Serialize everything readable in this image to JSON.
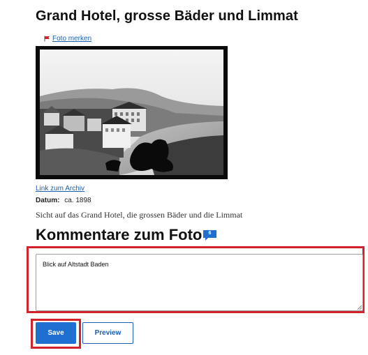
{
  "photo": {
    "title": "Grand Hotel, grosse Bäder und Limmat",
    "bookmark_label": "Foto merken",
    "bookmark_icon": "flag-icon",
    "archive_link": "Link zum Archiv",
    "date_label": "Datum:",
    "date_value": "ca. 1898",
    "description": "Sicht auf das Grand Hotel, die grossen Bäder und die Limmat"
  },
  "comments": {
    "heading": "Kommentare zum Foto",
    "count": "6",
    "count_icon": "speech-bubble-icon",
    "textarea_value": "Blick auf Altstadt Baden",
    "save_label": "Save",
    "preview_label": "Preview"
  },
  "colors": {
    "accent": "#1f6fd0",
    "link": "#1a5fb4",
    "highlight": "#d2232a",
    "flag": "#d2232a"
  }
}
